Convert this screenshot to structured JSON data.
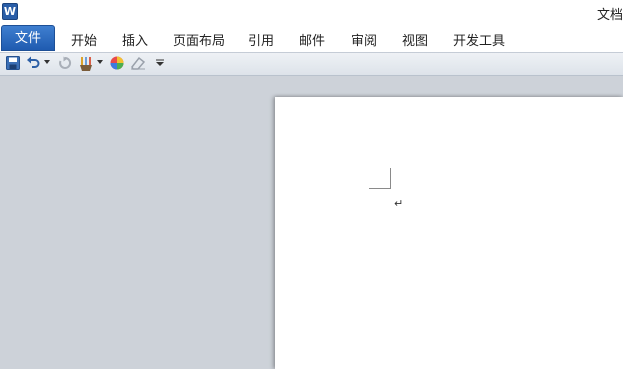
{
  "app": {
    "logo_letter": "W",
    "title": "文档"
  },
  "ribbon": {
    "file_tab": "文件",
    "tabs": [
      "开始",
      "插入",
      "页面布局",
      "引用",
      "邮件",
      "审阅",
      "视图",
      "开发工具"
    ]
  },
  "qat": {
    "icons": [
      "save-icon",
      "undo-icon",
      "dropdown-arrow-icon",
      "redo-icon",
      "paintbrush-icon",
      "dropdown-arrow-icon",
      "color-wheel-icon",
      "eraser-icon",
      "customize-dropdown-icon"
    ]
  },
  "document": {
    "cursor_mark": "↵"
  },
  "colors": {
    "file_tab": "#2a66bd",
    "workspace": "#cdd2d9",
    "page": "#ffffff"
  }
}
